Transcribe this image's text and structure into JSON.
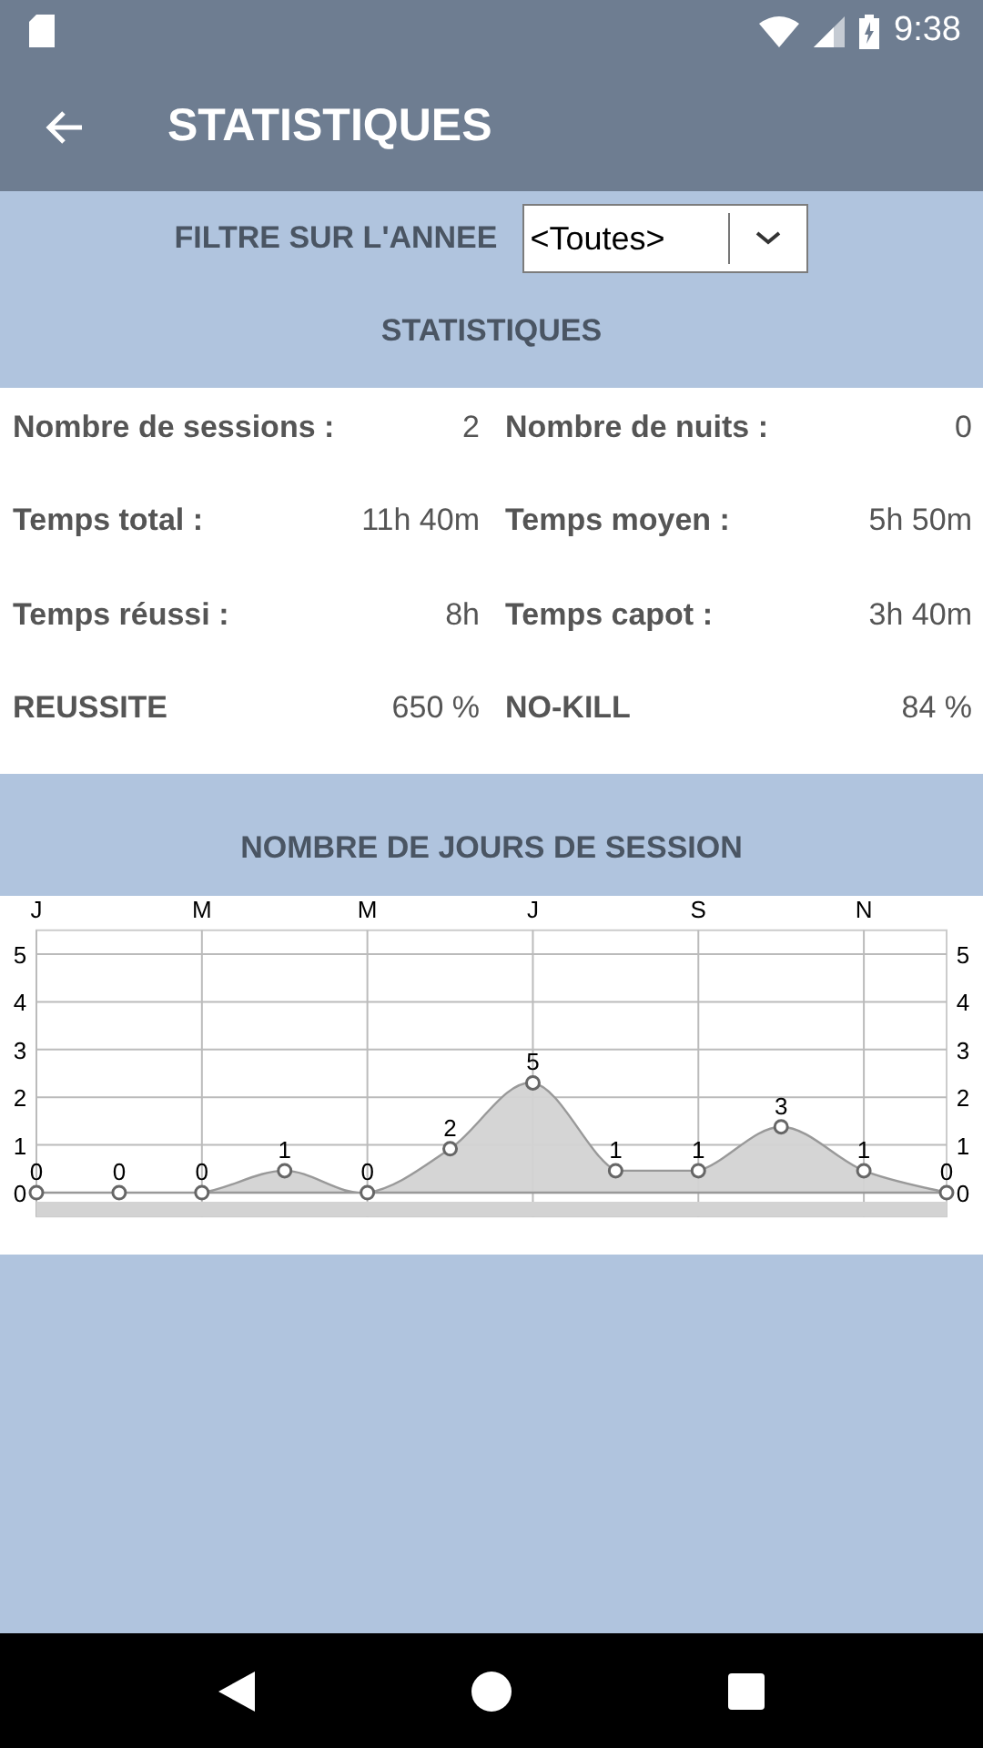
{
  "status_bar": {
    "time": "9:38"
  },
  "toolbar": {
    "title": "STATISTIQUES"
  },
  "filter": {
    "label": "FILTRE SUR L'ANNEE",
    "value": "<Toutes>"
  },
  "stats_heading": "STATISTIQUES",
  "stats": [
    {
      "label": "Nombre de sessions :",
      "value": "2"
    },
    {
      "label": "Nombre de nuits :",
      "value": "0"
    },
    {
      "label": "Temps total :",
      "value": "11h 40m"
    },
    {
      "label": "Temps moyen :",
      "value": "5h 50m"
    },
    {
      "label": "Temps réussi :",
      "value": "8h"
    },
    {
      "label": "Temps capot :",
      "value": "3h 40m"
    },
    {
      "label": "REUSSITE",
      "value": "650 %"
    },
    {
      "label": "NO-KILL",
      "value": "84 %"
    }
  ],
  "chart_heading": "NOMBRE DE JOURS DE SESSION",
  "chart_data": {
    "type": "area",
    "categories": [
      "J",
      null,
      "M",
      null,
      "M",
      null,
      "J",
      null,
      "S",
      null,
      "N",
      null
    ],
    "series": [
      {
        "color": "#d3d3d3",
        "values": [
          0,
          0,
          0,
          0.46,
          0,
          0.92,
          2.3,
          0.46,
          0.46,
          1.38,
          0.46,
          0
        ]
      }
    ],
    "ylim": [
      -0.5,
      5.5
    ],
    "yticks": [
      0,
      1,
      2,
      3,
      4,
      5
    ],
    "y2ticks": [
      0,
      1,
      2,
      3,
      4,
      5
    ],
    "y2lim": [
      -0.5,
      5.5
    ],
    "grid": true,
    "value_labels": [
      "0",
      "0",
      "0",
      "1",
      "0",
      "2",
      "5",
      "1",
      "1",
      "3",
      "1",
      "0"
    ]
  }
}
